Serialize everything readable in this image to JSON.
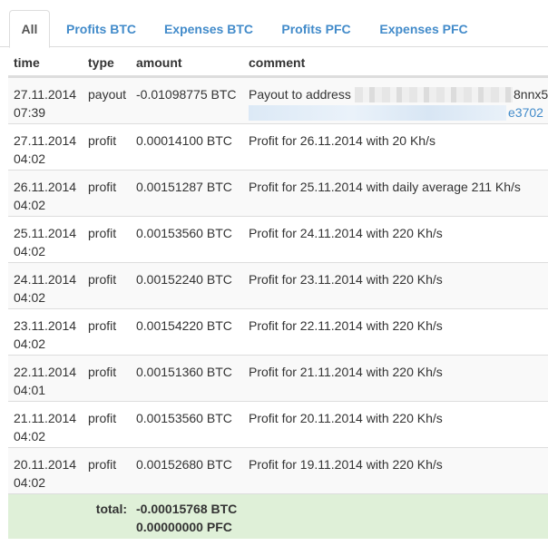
{
  "tabs": [
    {
      "label": "All",
      "active": true
    },
    {
      "label": "Profits BTC",
      "active": false
    },
    {
      "label": "Expenses BTC",
      "active": false
    },
    {
      "label": "Profits PFC",
      "active": false
    },
    {
      "label": "Expenses PFC",
      "active": false
    }
  ],
  "table": {
    "headers": {
      "time": "time",
      "type": "type",
      "amount": "amount",
      "comment": "comment"
    },
    "rows": [
      {
        "date": "27.11.2014",
        "clock": "07:39",
        "type": "payout",
        "amount": "-0.01098775 BTC",
        "comment": "Payout to address",
        "address_end": "8nnx5",
        "link_end": "e3702"
      },
      {
        "date": "27.11.2014",
        "clock": "04:02",
        "type": "profit",
        "amount": "0.00014100 BTC",
        "comment": "Profit for 26.11.2014 with 20 Kh/s"
      },
      {
        "date": "26.11.2014",
        "clock": "04:02",
        "type": "profit",
        "amount": "0.00151287 BTC",
        "comment": "Profit for 25.11.2014 with daily average 211 Kh/s"
      },
      {
        "date": "25.11.2014",
        "clock": "04:02",
        "type": "profit",
        "amount": "0.00153560 BTC",
        "comment": "Profit for 24.11.2014 with 220 Kh/s"
      },
      {
        "date": "24.11.2014",
        "clock": "04:02",
        "type": "profit",
        "amount": "0.00152240 BTC",
        "comment": "Profit for 23.11.2014 with 220 Kh/s"
      },
      {
        "date": "23.11.2014",
        "clock": "04:02",
        "type": "profit",
        "amount": "0.00154220 BTC",
        "comment": "Profit for 22.11.2014 with 220 Kh/s"
      },
      {
        "date": "22.11.2014",
        "clock": "04:01",
        "type": "profit",
        "amount": "0.00151360 BTC",
        "comment": "Profit for 21.11.2014 with 220 Kh/s"
      },
      {
        "date": "21.11.2014",
        "clock": "04:02",
        "type": "profit",
        "amount": "0.00153560 BTC",
        "comment": "Profit for 20.11.2014 with 220 Kh/s"
      },
      {
        "date": "20.11.2014",
        "clock": "04:02",
        "type": "profit",
        "amount": "0.00152680 BTC",
        "comment": "Profit for 19.11.2014 with 220 Kh/s"
      }
    ],
    "total": {
      "label": "total:",
      "btc": "-0.00015768 BTC",
      "pfc": "0.00000000 PFC"
    }
  },
  "colors": {
    "link": "#428bca",
    "total_bg": "#dff0d8",
    "stripe": "#f9f9f9",
    "border": "#dddddd"
  }
}
